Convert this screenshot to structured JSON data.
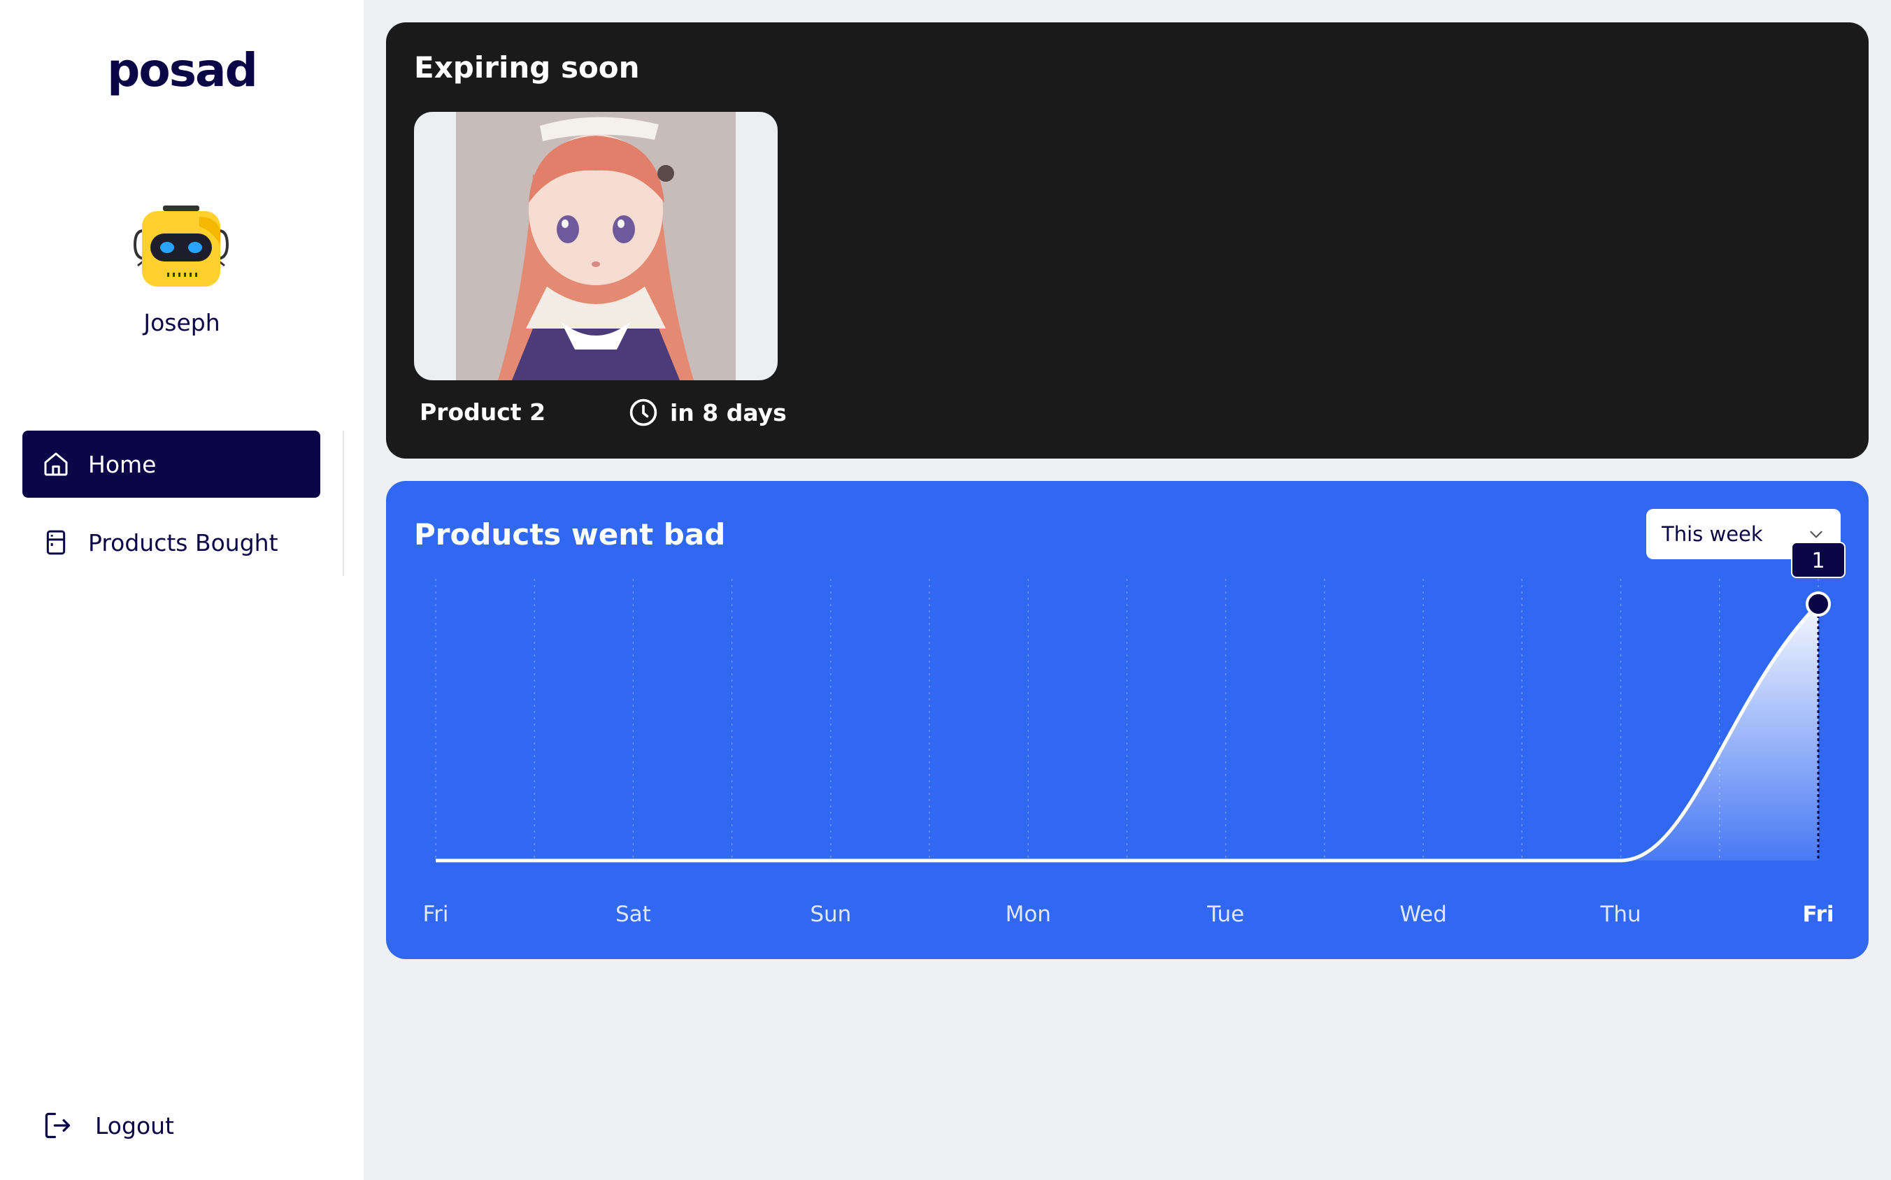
{
  "app": {
    "logo": "posad",
    "user": {
      "name": "Joseph"
    }
  },
  "sidebar": {
    "items": [
      {
        "label": "Home",
        "icon": "home-icon",
        "active": true
      },
      {
        "label": "Products Bought",
        "icon": "fridge-icon",
        "active": false
      }
    ],
    "logout": {
      "label": "Logout",
      "icon": "logout-icon"
    }
  },
  "expiring": {
    "title": "Expiring soon",
    "products": [
      {
        "name": "Product 2",
        "expires": "in 8 days",
        "image": "anime-maid-character-image"
      }
    ]
  },
  "went_bad": {
    "title": "Products went bad",
    "period": "This week",
    "highlight_value": "1"
  },
  "colors": {
    "navy": "#0b0646",
    "card_dark": "#1a1a1a",
    "chart_blue": "#3068f2",
    "page_bg": "#eff0f4"
  },
  "chart_data": {
    "type": "area",
    "categories": [
      "Fri",
      "Sat",
      "Sun",
      "Mon",
      "Tue",
      "Wed",
      "Thu",
      "Fri"
    ],
    "values": [
      0,
      0,
      0,
      0,
      0,
      0,
      0,
      1
    ],
    "ylim": [
      0,
      1
    ],
    "grid": "vertical dotted",
    "highlight_index": 7
  }
}
